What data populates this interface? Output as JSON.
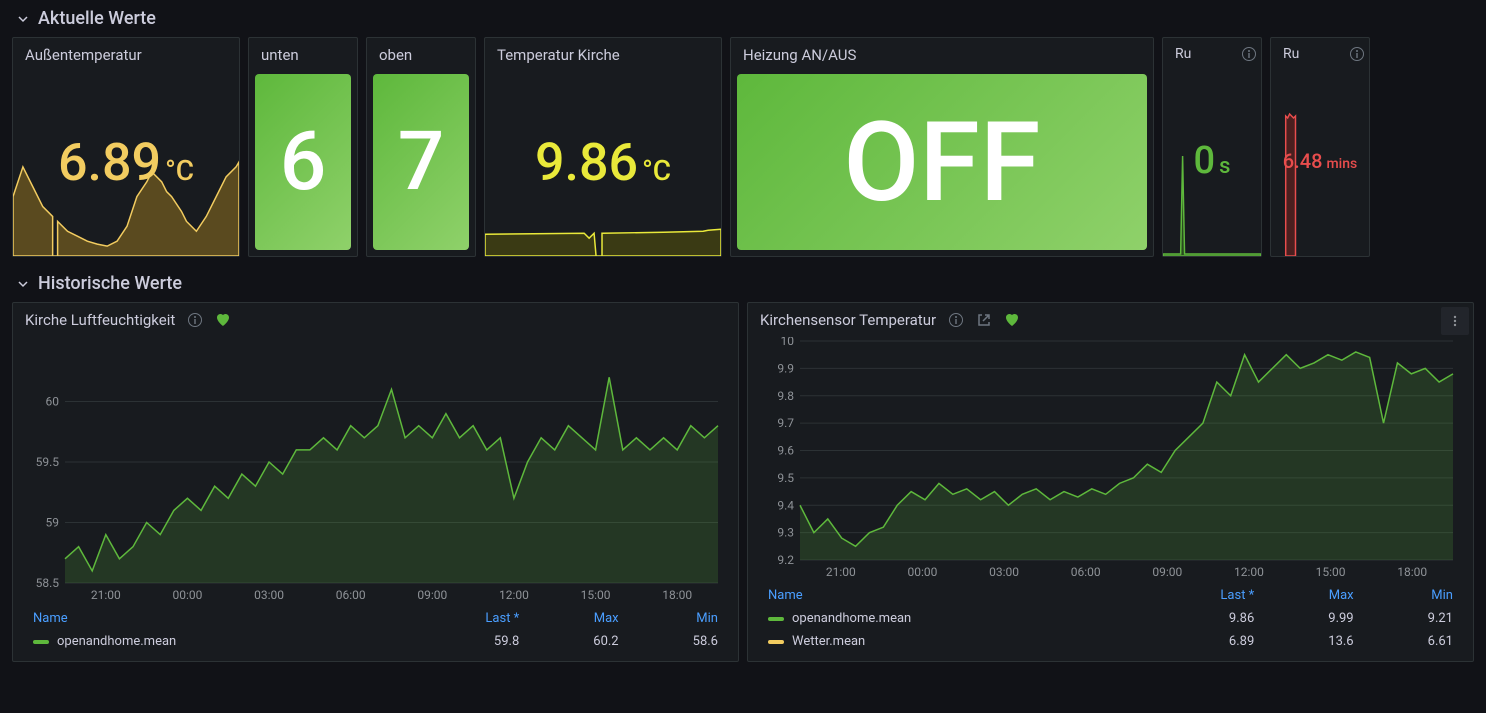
{
  "sections": {
    "current": "Aktuelle Werte",
    "historic": "Historische Werte"
  },
  "panels": {
    "outside_temp": {
      "title": "Außentemperatur",
      "value": "6.89",
      "unit": "°C",
      "color": "#f2cc60"
    },
    "unten": {
      "title": "unten",
      "value": "6"
    },
    "oben": {
      "title": "oben",
      "value": "7"
    },
    "kirche_temp": {
      "title": "Temperatur Kirche",
      "value": "9.86",
      "unit": "°C",
      "color": "#e9e93a"
    },
    "heating": {
      "title": "Heizung AN/AUS",
      "value": "OFF"
    },
    "ru1": {
      "title": "Ru",
      "value": "0",
      "unit": "s",
      "color": "#5eb83c"
    },
    "ru2": {
      "title": "Ru",
      "value": "6.48",
      "unit": "mins",
      "color": "#e84d4d"
    }
  },
  "charts": {
    "humidity": {
      "title": "Kirche Luftfeuchtigkeit",
      "legend_headers": [
        "Name",
        "Last *",
        "Max",
        "Min"
      ],
      "series": [
        {
          "name": "openandhome.mean",
          "color": "#5eb83c",
          "last": "59.8",
          "max": "60.2",
          "min": "58.6"
        }
      ]
    },
    "temperature": {
      "title": "Kirchensensor Temperatur",
      "legend_headers": [
        "Name",
        "Last *",
        "Max",
        "Min"
      ],
      "series": [
        {
          "name": "openandhome.mean",
          "color": "#5eb83c",
          "last": "9.86",
          "max": "9.99",
          "min": "9.21"
        },
        {
          "name": "Wetter.mean",
          "color": "#f2cc60",
          "last": "6.89",
          "max": "13.6",
          "min": "6.61"
        }
      ]
    }
  },
  "chart_data": [
    {
      "type": "line",
      "title": "Kirche Luftfeuchtigkeit",
      "xlabel": "",
      "ylabel": "",
      "ylim": [
        58.5,
        60.5
      ],
      "x_ticks": [
        "21:00",
        "00:00",
        "03:00",
        "06:00",
        "09:00",
        "12:00",
        "15:00",
        "18:00"
      ],
      "y_ticks": [
        58.5,
        59,
        59.5,
        60
      ],
      "series": [
        {
          "name": "openandhome.mean",
          "values": [
            58.7,
            58.8,
            58.6,
            58.9,
            58.7,
            58.8,
            59.0,
            58.9,
            59.1,
            59.2,
            59.1,
            59.3,
            59.2,
            59.4,
            59.3,
            59.5,
            59.4,
            59.6,
            59.6,
            59.7,
            59.6,
            59.8,
            59.7,
            59.8,
            60.1,
            59.7,
            59.8,
            59.7,
            59.9,
            59.7,
            59.8,
            59.6,
            59.7,
            59.2,
            59.5,
            59.7,
            59.6,
            59.8,
            59.7,
            59.6,
            60.2,
            59.6,
            59.7,
            59.6,
            59.7,
            59.6,
            59.8,
            59.7,
            59.8
          ]
        }
      ]
    },
    {
      "type": "line",
      "title": "Kirchensensor Temperatur",
      "xlabel": "",
      "ylabel": "",
      "ylim": [
        9.2,
        10
      ],
      "x_ticks": [
        "21:00",
        "00:00",
        "03:00",
        "06:00",
        "09:00",
        "12:00",
        "15:00",
        "18:00"
      ],
      "y_ticks": [
        9.2,
        9.3,
        9.4,
        9.5,
        9.6,
        9.7,
        9.8,
        9.9,
        10
      ],
      "series": [
        {
          "name": "openandhome.mean",
          "values": [
            9.4,
            9.3,
            9.35,
            9.28,
            9.25,
            9.3,
            9.32,
            9.4,
            9.45,
            9.42,
            9.48,
            9.44,
            9.46,
            9.42,
            9.45,
            9.4,
            9.44,
            9.46,
            9.42,
            9.45,
            9.43,
            9.46,
            9.44,
            9.48,
            9.5,
            9.55,
            9.52,
            9.6,
            9.65,
            9.7,
            9.85,
            9.8,
            9.95,
            9.85,
            9.9,
            9.95,
            9.9,
            9.92,
            9.95,
            9.93,
            9.96,
            9.94,
            9.7,
            9.92,
            9.88,
            9.9,
            9.85,
            9.88
          ]
        }
      ]
    }
  ]
}
